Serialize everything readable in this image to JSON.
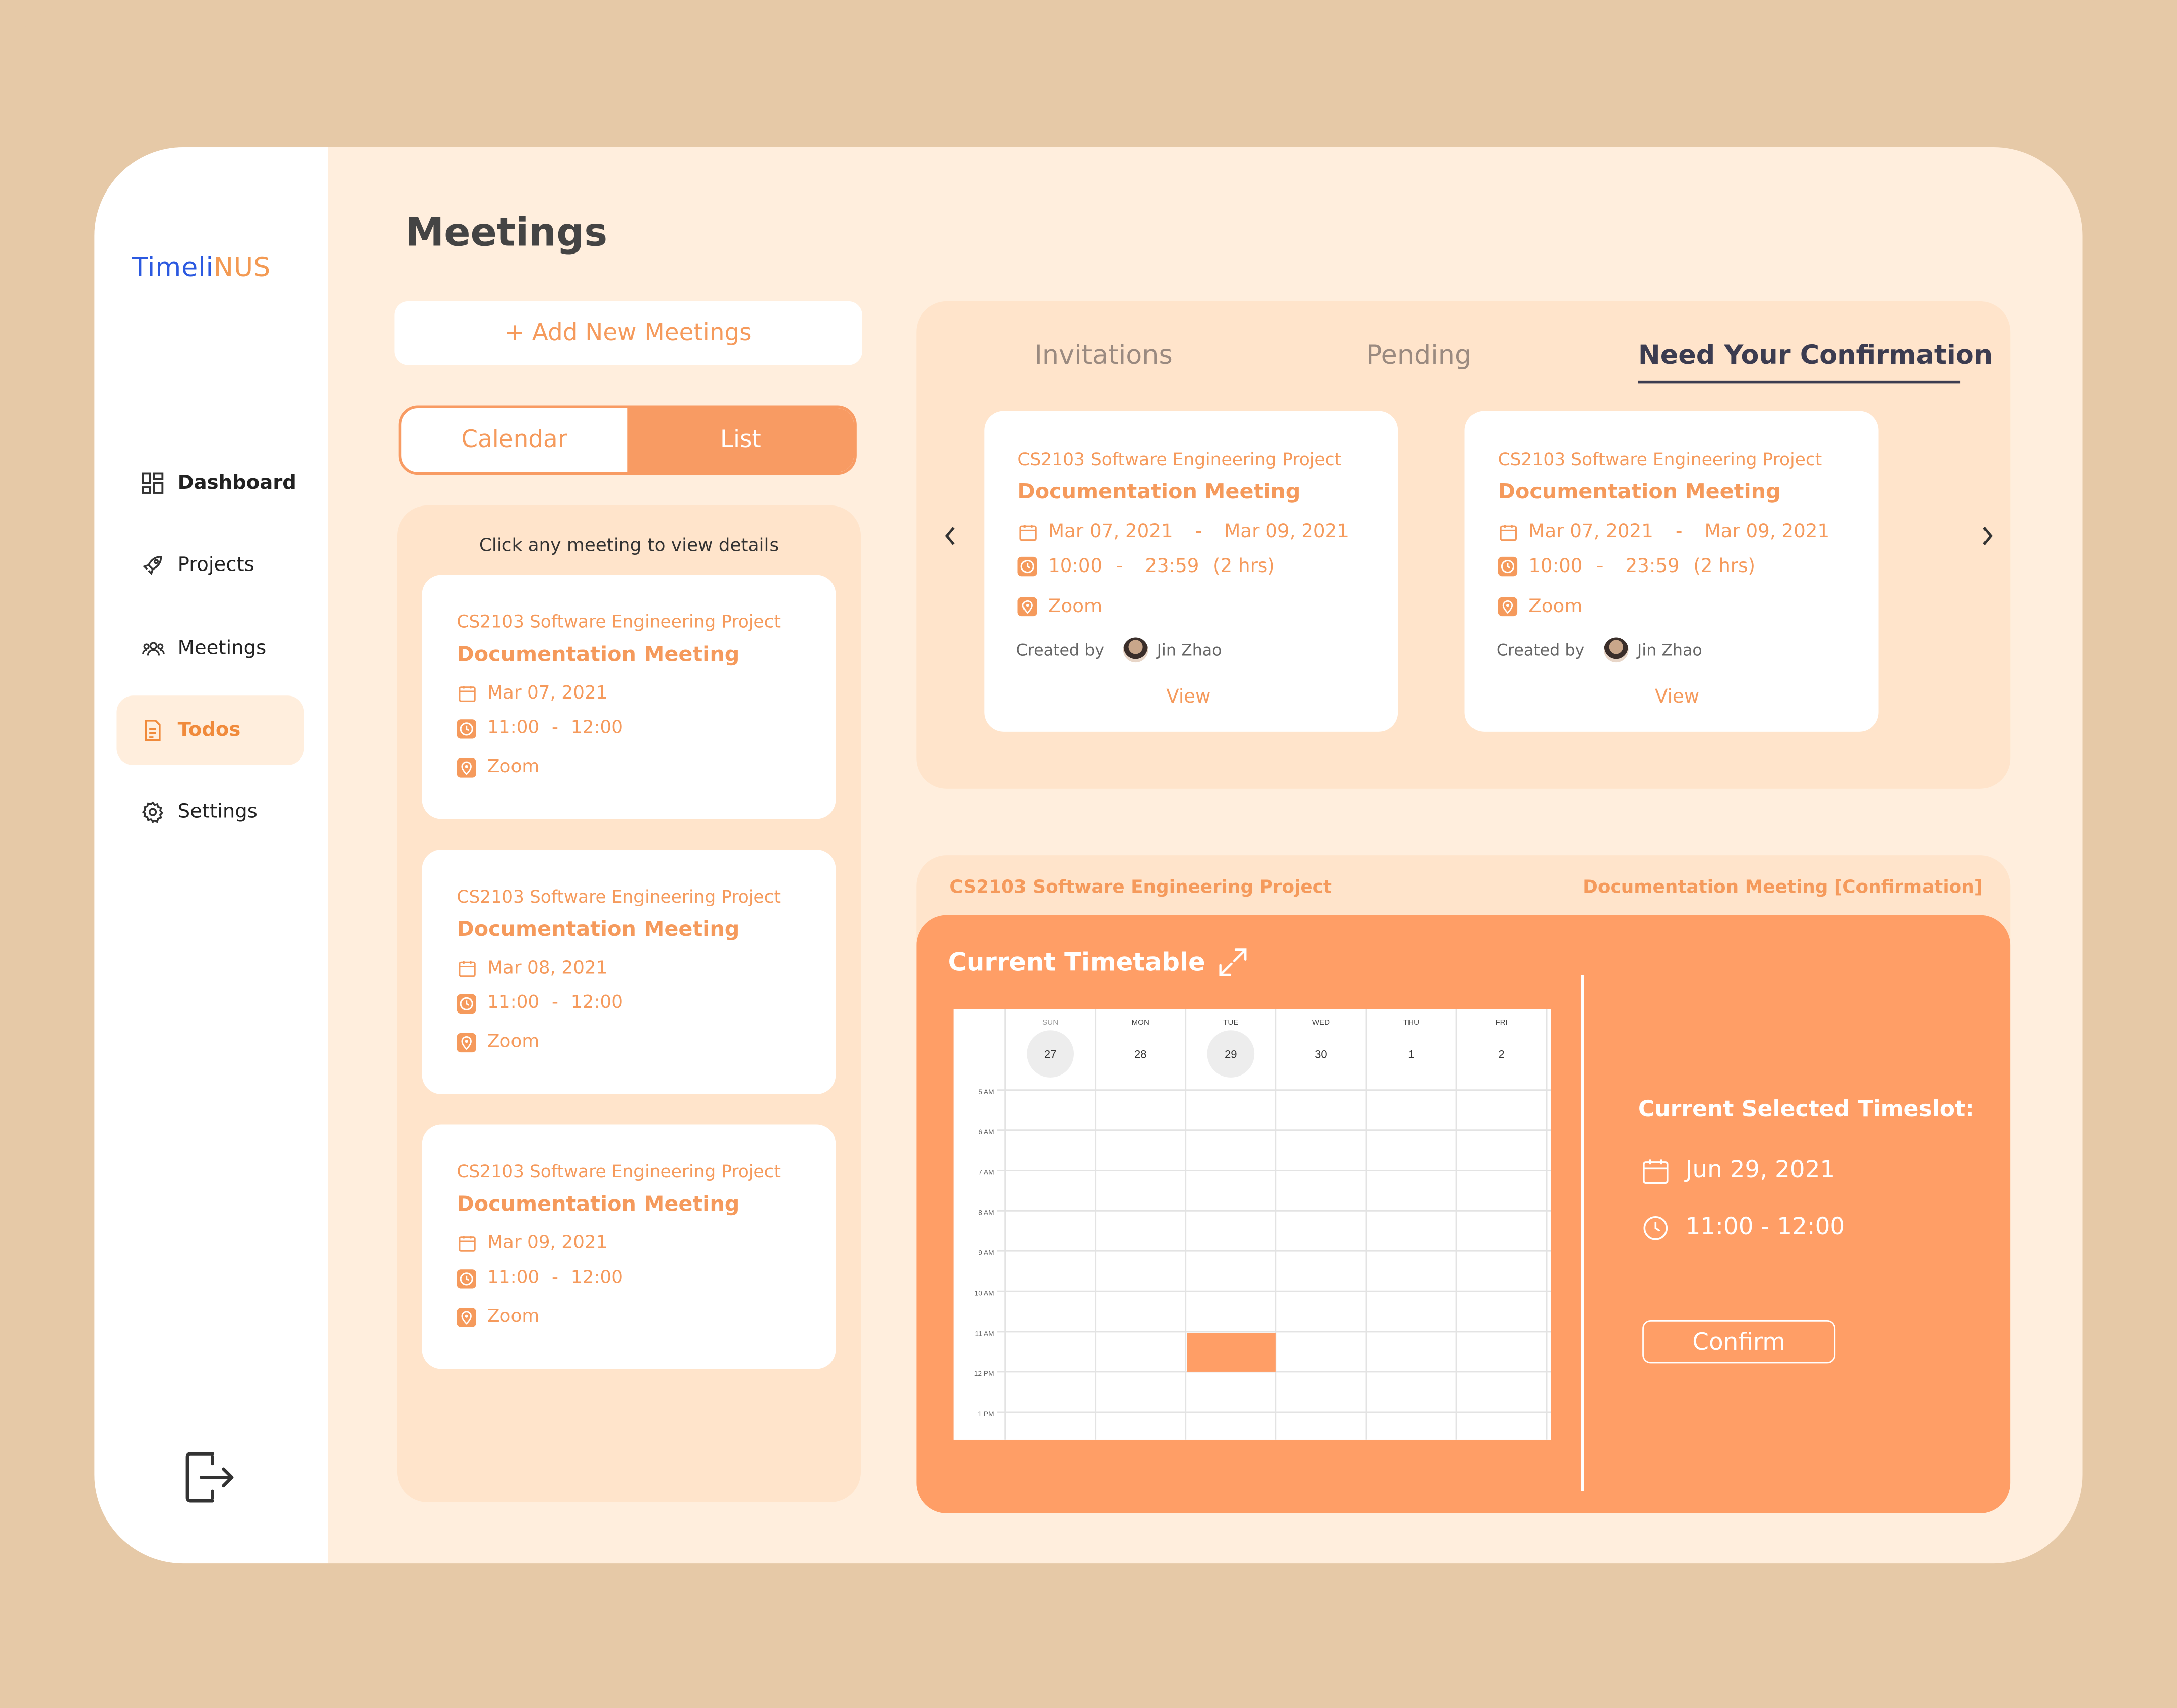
{
  "app": {
    "logo_part1": "Timeli",
    "logo_part2": "NUS"
  },
  "sidebar": {
    "items": [
      {
        "label": "Dashboard",
        "icon": "grid-icon",
        "active": false
      },
      {
        "label": "Projects",
        "icon": "rocket-icon",
        "active": false
      },
      {
        "label": "Meetings",
        "icon": "people-icon",
        "active": false
      },
      {
        "label": "Todos",
        "icon": "document-icon",
        "active": true
      },
      {
        "label": "Settings",
        "icon": "gear-icon",
        "active": false
      }
    ],
    "logout_icon": "logout-icon"
  },
  "page": {
    "title": "Meetings",
    "add_button": "+ Add New Meetings",
    "view_toggle": {
      "calendar": "Calendar",
      "list": "List",
      "selected": "List"
    }
  },
  "list": {
    "hint": "Click any meeting to view details",
    "meetings": [
      {
        "project": "CS2103 Software Engineering Project",
        "name": "Documentation Meeting",
        "date": "Mar 07, 2021",
        "time_start": "11:00",
        "time_sep": "-",
        "time_end": "12:00",
        "location": "Zoom"
      },
      {
        "project": "CS2103 Software Engineering Project",
        "name": "Documentation Meeting",
        "date": "Mar 08, 2021",
        "time_start": "11:00",
        "time_sep": "-",
        "time_end": "12:00",
        "location": "Zoom"
      },
      {
        "project": "CS2103 Software Engineering Project",
        "name": "Documentation Meeting",
        "date": "Mar 09, 2021",
        "time_start": "11:00",
        "time_sep": "-",
        "time_end": "12:00",
        "location": "Zoom"
      }
    ]
  },
  "invitations": {
    "tabs": [
      {
        "label": "Invitations",
        "active": false
      },
      {
        "label": "Pending",
        "active": false
      },
      {
        "label": "Need Your Confirmation",
        "active": true
      }
    ],
    "cards": [
      {
        "project": "CS2103 Software Engineering Project",
        "name": "Documentation Meeting",
        "date_start": "Mar 07, 2021",
        "date_sep": "-",
        "date_end": "Mar 09, 2021",
        "time_start": "10:00",
        "time_sep": "-",
        "time_end": "23:59",
        "duration": "(2 hrs)",
        "location": "Zoom",
        "created_by_label": "Created by",
        "creator": "Jin Zhao",
        "view_label": "View"
      },
      {
        "project": "CS2103 Software Engineering Project",
        "name": "Documentation Meeting",
        "date_start": "Mar 07, 2021",
        "date_sep": "-",
        "date_end": "Mar 09, 2021",
        "time_start": "10:00",
        "time_sep": "-",
        "time_end": "23:59",
        "duration": "(2 hrs)",
        "location": "Zoom",
        "created_by_label": "Created by",
        "creator": "Jin Zhao",
        "view_label": "View"
      }
    ]
  },
  "confirmation": {
    "project": "CS2103 Software Engineering Project",
    "meeting": "Documentation Meeting [Confirmation]",
    "timetable_title": "Current Timetable",
    "selected_title": "Current Selected Timeslot:",
    "selected_date": "Jun 29, 2021",
    "selected_time": "11:00 - 12:00",
    "confirm_label": "Confirm",
    "calendar": {
      "days": [
        {
          "dow": "SUN",
          "date": "27",
          "circled": true
        },
        {
          "dow": "MON",
          "date": "28",
          "circled": false
        },
        {
          "dow": "TUE",
          "date": "29",
          "circled": true
        },
        {
          "dow": "WED",
          "date": "30",
          "circled": false
        },
        {
          "dow": "THU",
          "date": "1",
          "circled": false
        },
        {
          "dow": "FRI",
          "date": "2",
          "circled": false
        }
      ],
      "hours": [
        "5 AM",
        "6 AM",
        "7 AM",
        "8 AM",
        "9 AM",
        "10 AM",
        "11 AM",
        "12 PM",
        "1 PM"
      ],
      "event": {
        "day": "TUE",
        "start": "11 AM",
        "end": "12 PM"
      }
    }
  },
  "colors": {
    "accent": "#FF9E66",
    "accent_text": "#F59A5C",
    "panel": "#FFE4CB",
    "background": "#FFEEDD",
    "frame": "#E6C9A7",
    "logo_blue": "#2B59E0"
  }
}
